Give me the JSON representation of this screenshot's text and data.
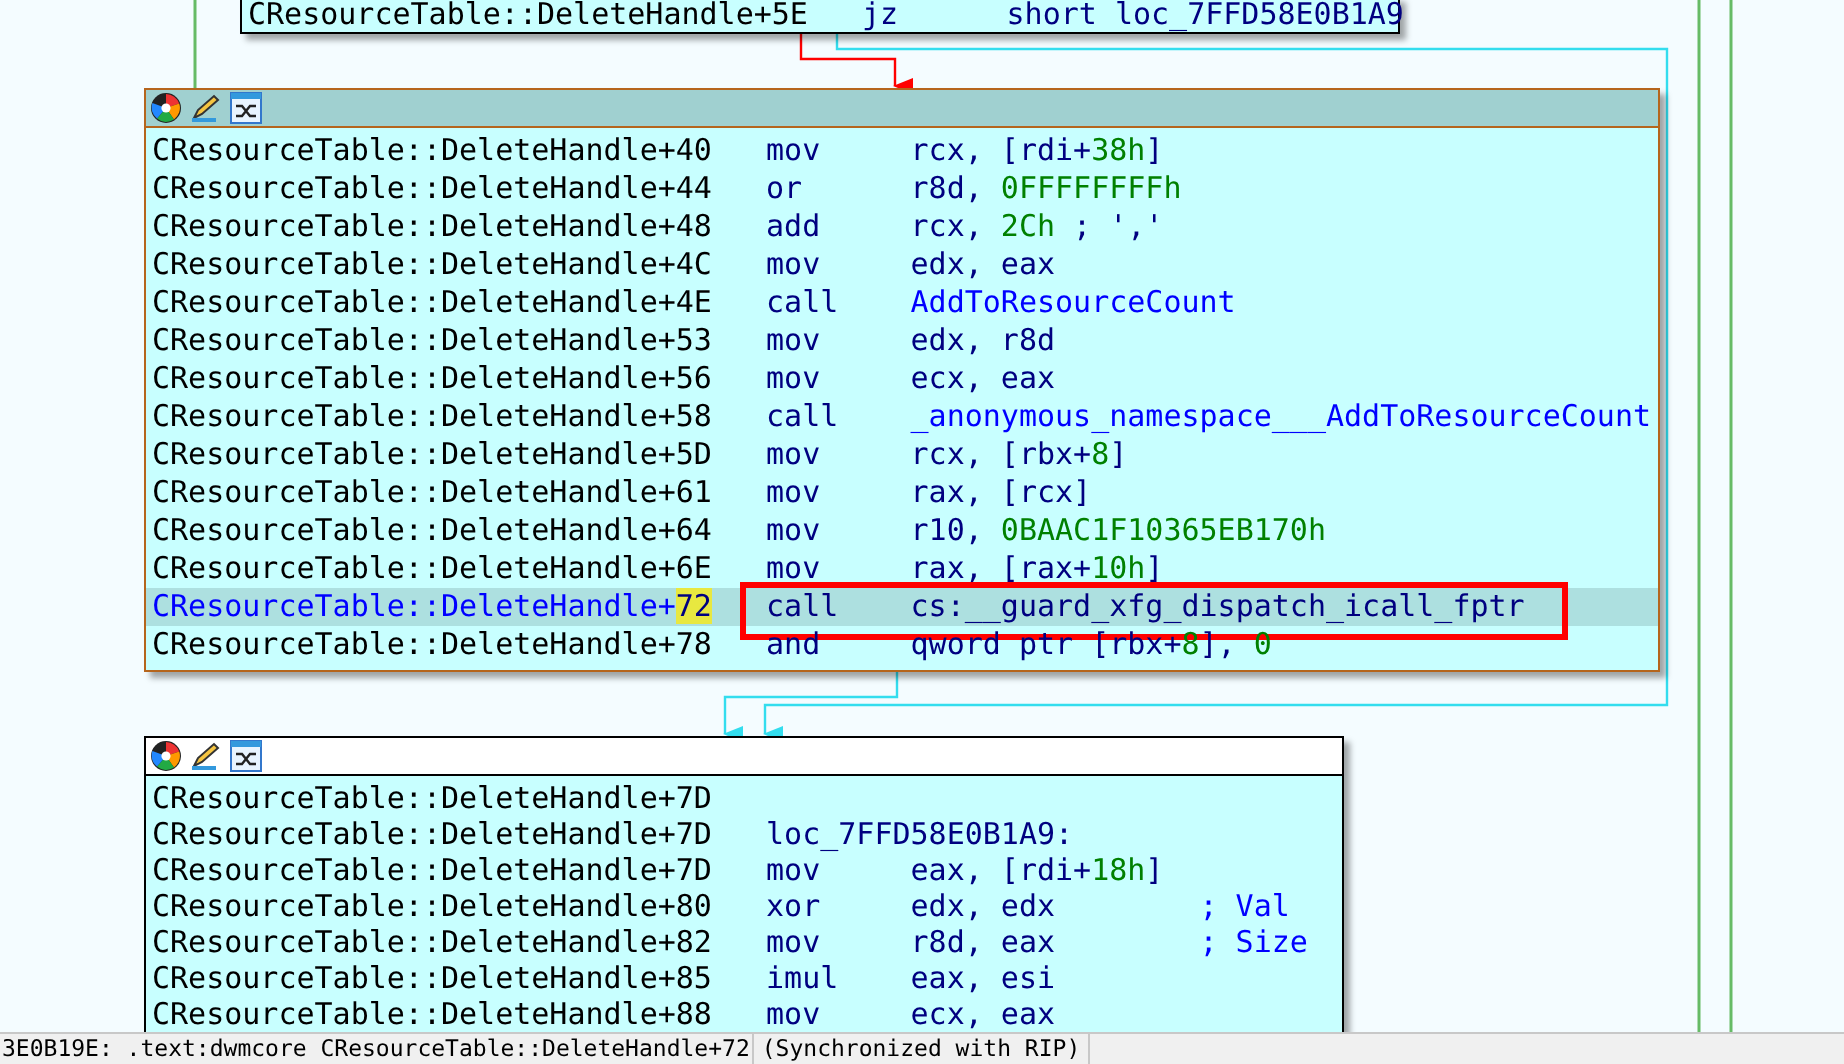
{
  "graph": {
    "nodes": [
      {
        "selected": false,
        "rows": [
          {
            "kind": "insn",
            "address": "CResourceTable::DeleteHandle+5E",
            "mnemonic": "jz",
            "operand": [
              {
                "kind": "plain",
                "text": "short loc_7FFD58E0B1A9"
              }
            ],
            "current": false,
            "boxed": false
          }
        ]
      },
      {
        "selected": true,
        "rows": [
          {
            "kind": "insn",
            "address": "CResourceTable::DeleteHandle+40",
            "mnemonic": "mov",
            "operand": [
              {
                "kind": "plain",
                "text": "rcx, [rdi+"
              },
              {
                "kind": "num",
                "text": "38h"
              },
              {
                "kind": "plain",
                "text": "]"
              }
            ],
            "current": false,
            "boxed": false
          },
          {
            "kind": "insn",
            "address": "CResourceTable::DeleteHandle+44",
            "mnemonic": "or",
            "operand": [
              {
                "kind": "plain",
                "text": "r8d, "
              },
              {
                "kind": "num",
                "text": "0FFFFFFFFh"
              }
            ],
            "current": false,
            "boxed": false
          },
          {
            "kind": "insn",
            "address": "CResourceTable::DeleteHandle+48",
            "mnemonic": "add",
            "operand": [
              {
                "kind": "plain",
                "text": "rcx, "
              },
              {
                "kind": "num",
                "text": "2Ch"
              },
              {
                "kind": "comment",
                "text": " ; ','"
              }
            ],
            "current": false,
            "boxed": false
          },
          {
            "kind": "insn",
            "address": "CResourceTable::DeleteHandle+4C",
            "mnemonic": "mov",
            "operand": [
              {
                "kind": "plain",
                "text": "edx, eax"
              }
            ],
            "current": false,
            "boxed": false
          },
          {
            "kind": "insn",
            "address": "CResourceTable::DeleteHandle+4E",
            "mnemonic": "call",
            "operand": [
              {
                "kind": "name",
                "text": "AddToResourceCount"
              }
            ],
            "current": false,
            "boxed": false
          },
          {
            "kind": "insn",
            "address": "CResourceTable::DeleteHandle+53",
            "mnemonic": "mov",
            "operand": [
              {
                "kind": "plain",
                "text": "edx, r8d"
              }
            ],
            "current": false,
            "boxed": false
          },
          {
            "kind": "insn",
            "address": "CResourceTable::DeleteHandle+56",
            "mnemonic": "mov",
            "operand": [
              {
                "kind": "plain",
                "text": "ecx, eax"
              }
            ],
            "current": false,
            "boxed": false
          },
          {
            "kind": "insn",
            "address": "CResourceTable::DeleteHandle+58",
            "mnemonic": "call",
            "operand": [
              {
                "kind": "name",
                "text": "_anonymous_namespace___AddToResourceCount"
              }
            ],
            "current": false,
            "boxed": false
          },
          {
            "kind": "insn",
            "address": "CResourceTable::DeleteHandle+5D",
            "mnemonic": "mov",
            "operand": [
              {
                "kind": "plain",
                "text": "rcx, [rbx+"
              },
              {
                "kind": "num",
                "text": "8"
              },
              {
                "kind": "plain",
                "text": "]"
              }
            ],
            "current": false,
            "boxed": false
          },
          {
            "kind": "insn",
            "address": "CResourceTable::DeleteHandle+61",
            "mnemonic": "mov",
            "operand": [
              {
                "kind": "plain",
                "text": "rax, [rcx]"
              }
            ],
            "current": false,
            "boxed": false
          },
          {
            "kind": "insn",
            "address": "CResourceTable::DeleteHandle+64",
            "mnemonic": "mov",
            "operand": [
              {
                "kind": "plain",
                "text": "r10, "
              },
              {
                "kind": "num",
                "text": "0BAAC1F10365EB170h"
              }
            ],
            "current": false,
            "boxed": false
          },
          {
            "kind": "insn",
            "address": "CResourceTable::DeleteHandle+6E",
            "mnemonic": "mov",
            "operand": [
              {
                "kind": "plain",
                "text": "rax, [rax+"
              },
              {
                "kind": "num",
                "text": "10h"
              },
              {
                "kind": "plain",
                "text": "]"
              }
            ],
            "current": false,
            "boxed": false
          },
          {
            "kind": "insn",
            "address": "CResourceTable::DeleteHandle+72",
            "mnemonic": "call",
            "operand": [
              {
                "kind": "plain",
                "text": "cs:__guard_xfg_dispatch_icall_fptr"
              }
            ],
            "current": true,
            "boxed": true
          },
          {
            "kind": "insn",
            "address": "CResourceTable::DeleteHandle+78",
            "mnemonic": "and",
            "operand": [
              {
                "kind": "plain",
                "text": "qword ptr [rbx+"
              },
              {
                "kind": "num",
                "text": "8"
              },
              {
                "kind": "plain",
                "text": "], "
              },
              {
                "kind": "num",
                "text": "0"
              }
            ],
            "current": false,
            "boxed": false
          }
        ]
      },
      {
        "selected": false,
        "rows": [
          {
            "kind": "blank",
            "address": "CResourceTable::DeleteHandle+7D",
            "current": false,
            "boxed": false
          },
          {
            "kind": "label",
            "address": "CResourceTable::DeleteHandle+7D",
            "label": "loc_7FFD58E0B1A9:",
            "current": false,
            "boxed": false
          },
          {
            "kind": "insn",
            "address": "CResourceTable::DeleteHandle+7D",
            "mnemonic": "mov",
            "operand": [
              {
                "kind": "plain",
                "text": "eax, [rdi+"
              },
              {
                "kind": "num",
                "text": "18h"
              },
              {
                "kind": "plain",
                "text": "]"
              }
            ],
            "current": false,
            "boxed": false
          },
          {
            "kind": "insn",
            "address": "CResourceTable::DeleteHandle+80",
            "mnemonic": "xor",
            "operand": [
              {
                "kind": "plain",
                "text": "edx, edx"
              }
            ],
            "comment": "; Val",
            "current": false,
            "boxed": false
          },
          {
            "kind": "insn",
            "address": "CResourceTable::DeleteHandle+82",
            "mnemonic": "mov",
            "operand": [
              {
                "kind": "plain",
                "text": "r8d, eax"
              }
            ],
            "comment": "; Size",
            "current": false,
            "boxed": false
          },
          {
            "kind": "insn",
            "address": "CResourceTable::DeleteHandle+85",
            "mnemonic": "imul",
            "operand": [
              {
                "kind": "plain",
                "text": "eax, esi"
              }
            ],
            "current": false,
            "boxed": false
          },
          {
            "kind": "insn",
            "address": "CResourceTable::DeleteHandle+88",
            "mnemonic": "mov",
            "operand": [
              {
                "kind": "plain",
                "text": "ecx, eax"
              }
            ],
            "current": false,
            "boxed": false
          }
        ]
      }
    ]
  },
  "status_bar": {
    "location": "3E0B19E: .text:dwmcore CResourceTable::DeleteHandle+72",
    "sync": "(Synchronized with RIP)"
  }
}
